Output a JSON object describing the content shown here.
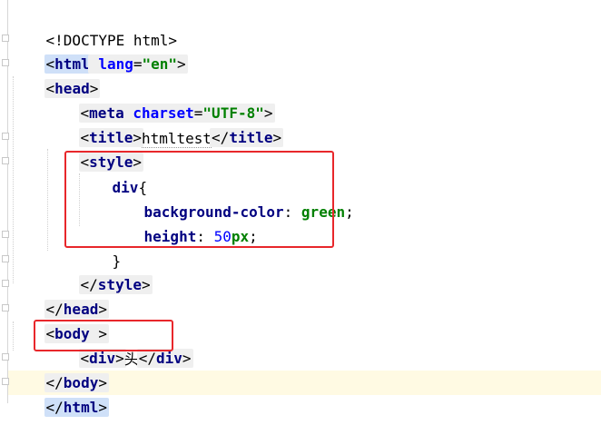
{
  "editor": {
    "lines": {
      "doctype": "<!DOCTYPE html>",
      "html_open": {
        "lt": "<",
        "tag": "html",
        "attr": "lang",
        "eq": "=",
        "val": "\"en\"",
        "gt": ">"
      },
      "head_open": {
        "lt": "<",
        "tag": "head",
        "gt": ">"
      },
      "meta": {
        "lt": "<",
        "tag": "meta",
        "attr": "charset",
        "eq": "=",
        "val": "\"UTF-8\"",
        "gt": ">"
      },
      "title": {
        "lt": "<",
        "tag": "title",
        "gt": ">",
        "text": "htmltest",
        "clt": "</",
        "ctag": "title",
        "cgt": ">"
      },
      "style_open": {
        "lt": "<",
        "tag": "style",
        "gt": ">"
      },
      "css_selector": {
        "sel": "div",
        "brace": "{"
      },
      "css_bg": {
        "prop": "background-color",
        "colon": ": ",
        "val": "green",
        "semi": ";"
      },
      "css_height": {
        "prop": "height",
        "colon": ": ",
        "num": "50",
        "unit": "px",
        "semi": ";"
      },
      "css_close": "}",
      "style_close": {
        "lt": "</",
        "tag": "style",
        "gt": ">"
      },
      "head_close": {
        "lt": "</",
        "tag": "head",
        "gt": ">"
      },
      "body_open": {
        "lt": "<",
        "tag": "body",
        "gt": ">"
      },
      "div_line": {
        "lt": "<",
        "tag": "div",
        "gt": ">",
        "text": "头",
        "clt": "</",
        "ctag": "div",
        "cgt": ">"
      },
      "body_close": {
        "lt": "</",
        "tag": "body",
        "gt": ">"
      },
      "html_close": {
        "lt": "</",
        "tag": "html",
        "gt": ">"
      }
    }
  }
}
